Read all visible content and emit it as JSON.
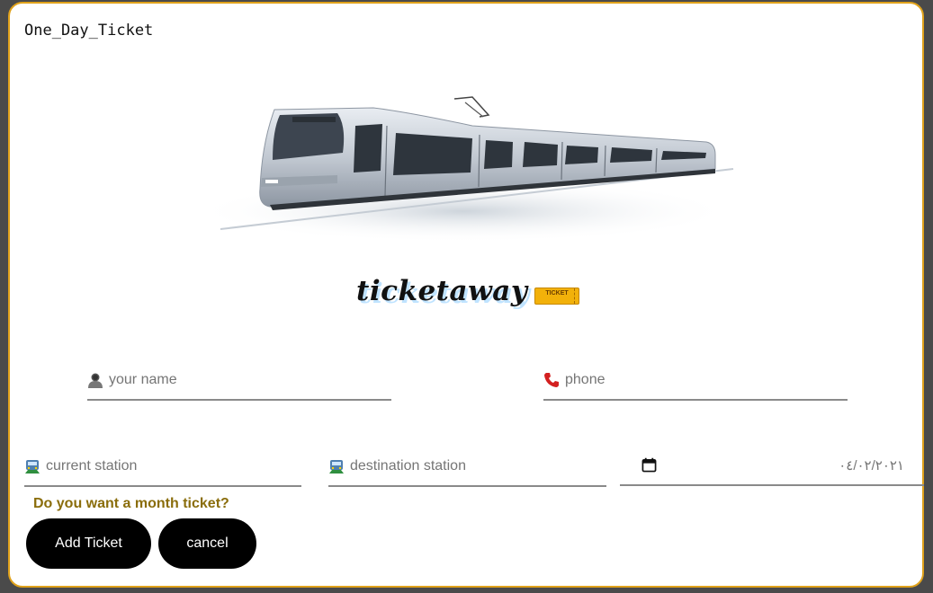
{
  "page": {
    "title": "One_Day_Ticket"
  },
  "brand": {
    "name": "ticketaway",
    "badge_text": "TICKET"
  },
  "form": {
    "name": {
      "placeholder": "your name",
      "value": "",
      "icon": "person-icon"
    },
    "phone": {
      "placeholder": "phone",
      "value": "",
      "icon": "phone-icon"
    },
    "current_station": {
      "placeholder": "current station",
      "value": "",
      "icon": "train-icon"
    },
    "destination_station": {
      "placeholder": "destination station",
      "value": "",
      "icon": "train-icon"
    },
    "date": {
      "value": "٠٤/٠٢/٢٠٢١",
      "icon": "calendar-icon"
    },
    "month_question": "Do you want a month ticket?"
  },
  "actions": {
    "add_label": "Add Ticket",
    "cancel_label": "cancel"
  },
  "colors": {
    "frame": "#e0a21b",
    "question": "#8a6d0b",
    "button_bg": "#000000"
  }
}
